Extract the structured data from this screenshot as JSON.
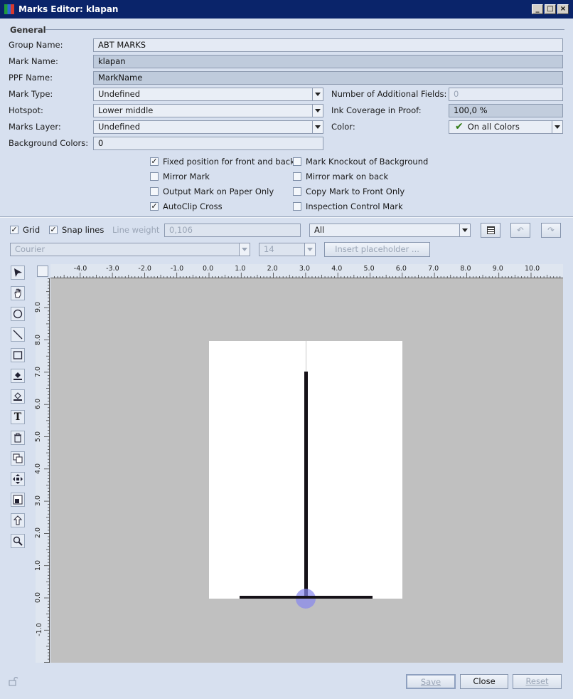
{
  "window": {
    "title": "Marks Editor: klapan"
  },
  "general": {
    "section_label": "General",
    "group_name_label": "Group Name:",
    "group_name_value": "ABT MARKS",
    "mark_name_label": "Mark Name:",
    "mark_name_value": "klapan",
    "ppf_name_label": "PPF Name:",
    "ppf_name_value": "MarkName",
    "mark_type_label": "Mark Type:",
    "mark_type_value": "Undefined",
    "hotspot_label": "Hotspot:",
    "hotspot_value": "Lower middle",
    "marks_layer_label": "Marks Layer:",
    "marks_layer_value": "Undefined",
    "background_colors_label": "Background Colors:",
    "background_colors_value": "0",
    "additional_fields_label": "Number of Additional Fields:",
    "additional_fields_value": "0",
    "ink_coverage_label": "Ink Coverage in Proof:",
    "ink_coverage_value": "100,0 %",
    "color_label": "Color:",
    "color_value": "On all Colors"
  },
  "options": {
    "fixed_position": {
      "label": "Fixed position for front and back",
      "checked": true
    },
    "mirror_mark": {
      "label": "Mirror Mark",
      "checked": false
    },
    "output_on_paper": {
      "label": "Output Mark on Paper Only",
      "checked": false
    },
    "autoclip_cross": {
      "label": "AutoClip Cross",
      "checked": true
    },
    "knockout": {
      "label": "Mark Knockout of Background",
      "checked": false
    },
    "mirror_back": {
      "label": "Mirror mark on back",
      "checked": false
    },
    "copy_front": {
      "label": "Copy Mark to Front Only",
      "checked": false
    },
    "inspection": {
      "label": "Inspection Control Mark",
      "checked": false
    }
  },
  "toolbar": {
    "grid_label": "Grid",
    "grid_checked": true,
    "snap_label": "Snap lines",
    "snap_checked": true,
    "line_weight_label": "Line weight",
    "line_weight_value": "0,106",
    "layer_select_value": "All",
    "font_value": "Courier",
    "font_size_value": "14",
    "insert_placeholder_label": "Insert placeholder ..."
  },
  "tools": [
    "select-arrow-icon",
    "hand-pan-icon",
    "circle-icon",
    "line-icon",
    "rectangle-icon",
    "fill-icon",
    "stroke-icon",
    "text-icon",
    "trash-icon",
    "duplicate-icon",
    "move-icon",
    "resize-icon",
    "bring-front-icon",
    "zoom-icon"
  ],
  "ruler_x": [
    "-4.0",
    "-3.0",
    "-2.0",
    "-1.0",
    "0.0",
    "1.0",
    "2.0",
    "3.0",
    "4.0",
    "5.0",
    "6.0",
    "7.0",
    "8.0",
    "9.0",
    "10.0"
  ],
  "ruler_y": [
    "9.0",
    "8.0",
    "7.0",
    "6.0",
    "5.0",
    "4.0",
    "3.0",
    "2.0",
    "1.0",
    "0.0",
    "-1.0"
  ],
  "buttons": {
    "save": "Save",
    "close": "Close",
    "reset": "Reset"
  },
  "colors": {
    "title_bg": "#0a246a",
    "canvas_bg": "#c0c0c0",
    "hotspot": "#8888ee"
  }
}
